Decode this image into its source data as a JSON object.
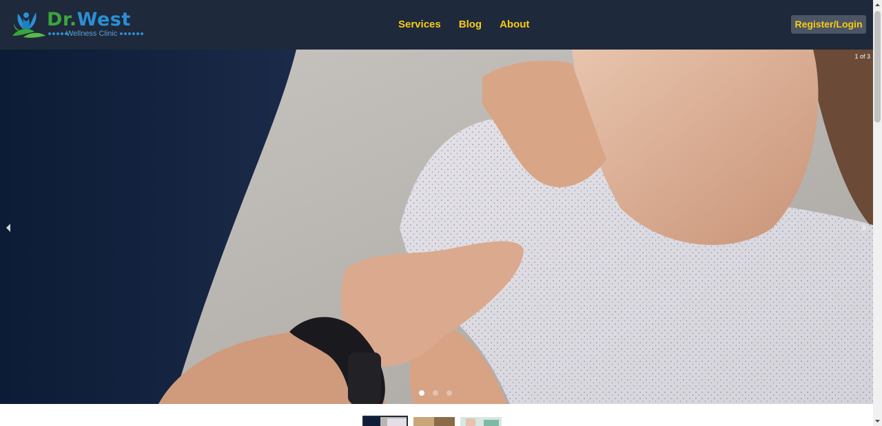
{
  "brand": {
    "name_part1": "Dr",
    "name_dot": ".",
    "name_part2": "West",
    "subtitle": "Wellness Clinic",
    "colors": {
      "green": "#3aa63a",
      "blue": "#2b8fd6"
    },
    "icon": "leaf-figure-logo-icon"
  },
  "nav": {
    "items": [
      {
        "label": "Services"
      },
      {
        "label": "Blog"
      },
      {
        "label": "About"
      }
    ],
    "color": "#facc15"
  },
  "header": {
    "register_label": "Register/Login",
    "background": "#1e293b"
  },
  "carousel": {
    "counter": "1 of 3",
    "current_slide": 1,
    "total_slides": 3,
    "prev_icon": "chevron-left-icon",
    "next_icon": "chevron-right-icon"
  },
  "thumbnails": [
    {
      "name": "massage-shoulder"
    },
    {
      "name": "therapy-session"
    },
    {
      "name": "clinic-patient"
    }
  ]
}
